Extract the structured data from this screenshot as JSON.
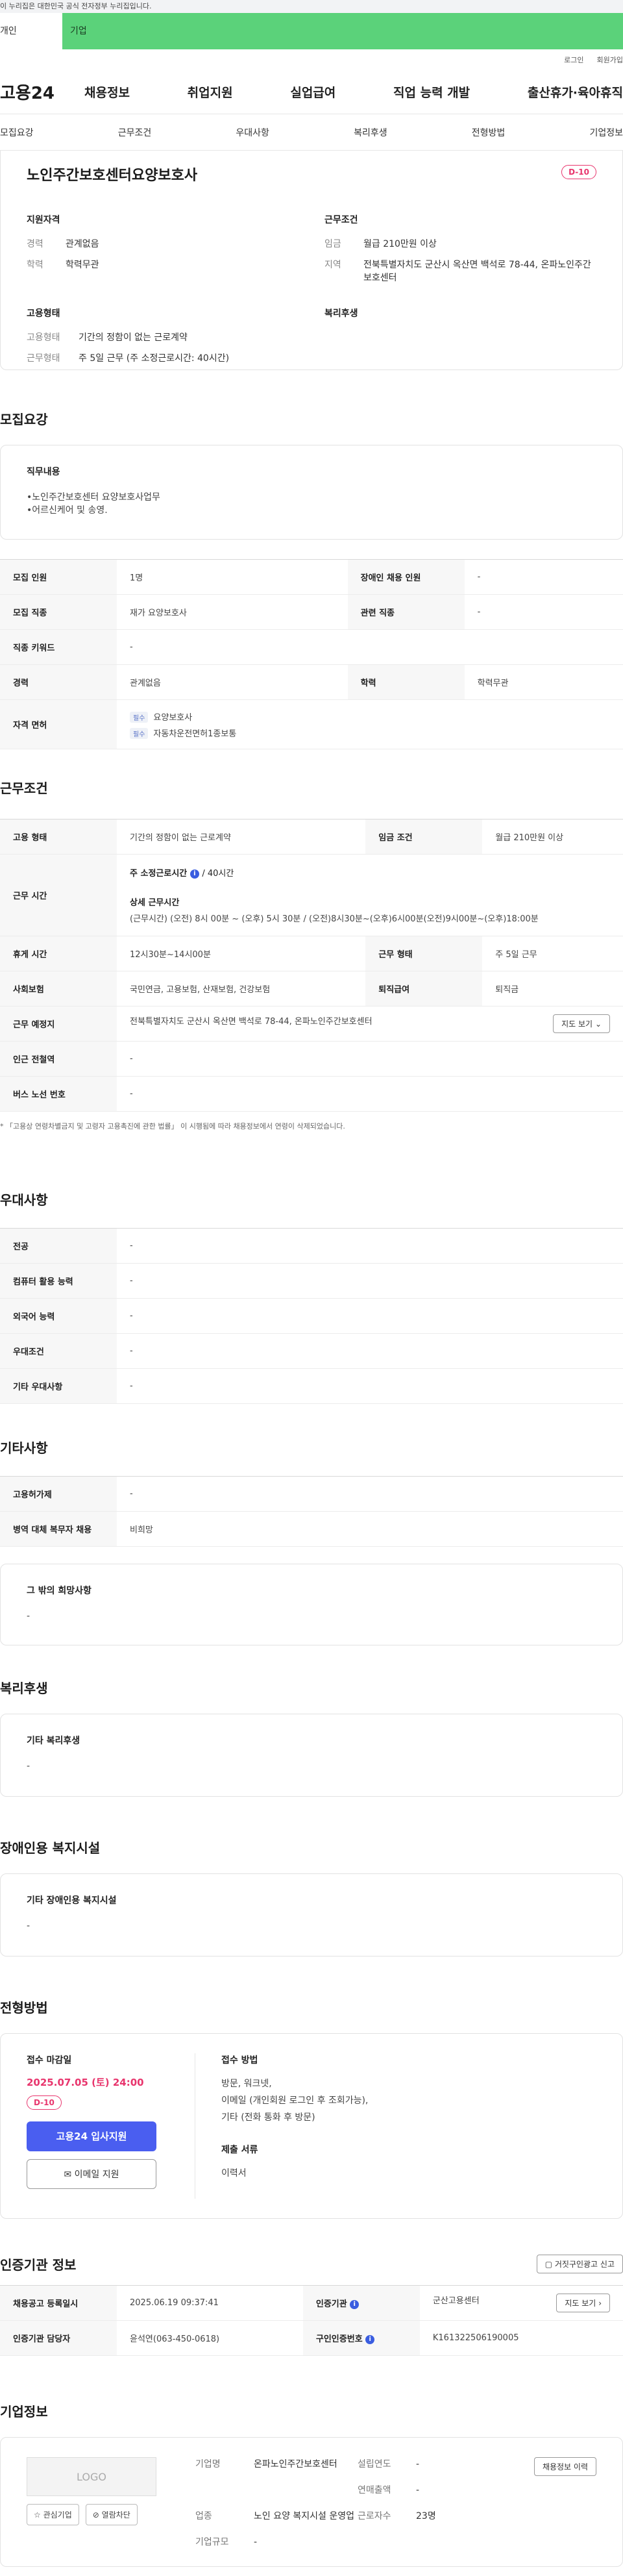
{
  "gov_notice": "이 누리집은 대한민국 공식 전자정부 누리집입니다.",
  "top_tabs": [
    "개인",
    "기업"
  ],
  "util_links": [
    "로그인",
    "회원가입"
  ],
  "gnb": {
    "logo": "고용24",
    "menu": [
      "채용정보",
      "취업지원",
      "실업급여",
      "직업 능력 개발",
      "출산휴가·육아휴직"
    ]
  },
  "anchor_nav": [
    "모집요강",
    "근무조건",
    "우대사항",
    "복리후생",
    "전형방법",
    "기업정보"
  ],
  "summary": {
    "title": "노인주간보호센터요양보호사",
    "dday": "D-10",
    "qualification": {
      "heading": "지원자격",
      "items": [
        {
          "k": "경력",
          "v": "관계없음"
        },
        {
          "k": "학력",
          "v": "학력무관"
        }
      ]
    },
    "conditions": {
      "heading": "근무조건",
      "items": [
        {
          "k": "임금",
          "v": "월급 210만원 이상"
        },
        {
          "k": "지역",
          "v": "전북특별자치도 군산시 옥산면 백석로 78-44, 온파노인주간보호센터"
        }
      ]
    },
    "employment": {
      "heading": "고용형태",
      "items": [
        {
          "k": "고용형태",
          "v": "기간의 정함이 없는 근로계약"
        },
        {
          "k": "근무형태",
          "v": "주 5일 근무 (주 소정근로시간: 40시간)"
        }
      ]
    },
    "welfare_heading": "복리후생"
  },
  "recruit": {
    "title": "모집요강",
    "duty_title": "직무내용",
    "duty_lines": [
      "•노인주간보호센터 요양보호사업무",
      "•어르신케어 및 송영."
    ],
    "rows": [
      {
        "k1": "모집 인원",
        "v1": "1명",
        "k2": "장애인 채용 인원",
        "v2": "-"
      },
      {
        "k1": "모집 직종",
        "v1": "재가 요양보호사",
        "k2": "관련 직종",
        "v2": "-"
      },
      {
        "k1": "직종 키워드",
        "v1": "-"
      },
      {
        "k1": "경력",
        "v1": "관계없음",
        "k2": "학력",
        "v2": "학력무관"
      }
    ],
    "license_label": "자격 면허",
    "license_badge": "필수",
    "licenses": [
      "요양보호사",
      "자동차운전면허1종보통"
    ]
  },
  "work": {
    "title": "근무조건",
    "rows": {
      "type_k": "고용 형태",
      "type_v": "기간의 정함이 없는 근로계약",
      "wage_k": "임금 조건",
      "wage_v": "월급 210만원 이상",
      "time_k": "근무 시간",
      "time_main": "주 소정근로시간",
      "time_main_value": "/ 40시간",
      "time_detail_title": "상세 근무시간",
      "time_detail": "(근무시간) (오전) 8시 00분 ~ (오후) 5시 30분 / (오전)8시30분~(오후)6시00분(오전)9시00분~(오후)18:00분",
      "break_k": "휴게 시간",
      "break_v": "12시30분~14시00분",
      "shift_k": "근무 형태",
      "shift_v": "주 5일 근무",
      "insurance_k": "사회보험",
      "insurance_v": "국민연금, 고용보험, 산재보험, 건강보험",
      "severance_k": "퇴직급여",
      "severance_v": "퇴직금",
      "place_k": "근무 예정지",
      "place_v": "전북특별자치도 군산시 옥산면 백석로 78-44, 온파노인주간보호센터",
      "map_btn": "지도 보기",
      "subway_k": "인근 전철역",
      "subway_v": "-",
      "bus_k": "버스 노선 번호",
      "bus_v": "-"
    },
    "note": "* 「고용상 연령차별금지 및 고령자 고용촉진에 관한 법률」 이 시행됨에 따라 채용정보에서 연령이 삭제되었습니다."
  },
  "preference": {
    "title": "우대사항",
    "rows": [
      {
        "k": "전공",
        "v": "-"
      },
      {
        "k": "컴퓨터 활용 능력",
        "v": "-"
      },
      {
        "k": "외국어 능력",
        "v": "-"
      },
      {
        "k": "우대조건",
        "v": "-"
      },
      {
        "k": "기타 우대사항",
        "v": "-"
      }
    ]
  },
  "etc": {
    "title": "기타사항",
    "rows": [
      {
        "k": "고용허가제",
        "v": "-"
      },
      {
        "k": "병역 대체 복무자 채용",
        "v": "비희망"
      }
    ],
    "other_title": "그 밖의 희망사항",
    "other_value": "-"
  },
  "welfare": {
    "title": "복리후생",
    "box_title": "기타 복리후생",
    "box_value": "-"
  },
  "disabled": {
    "title": "장애인용 복지시설",
    "box_title": "기타 장애인용 복지시설",
    "box_value": "-"
  },
  "process": {
    "title": "전형방법",
    "deadline_title": "접수 마감일",
    "deadline": "2025.07.05 (토) 24:00",
    "dday": "D-10",
    "apply_btn": "고용24 입사지원",
    "email_btn": "이메일 지원",
    "method_title": "접수 방법",
    "methods": [
      "방문, 워크넷,",
      "이메일 (개인회원 로그인 후 조회가능),",
      "기타 (전화 통화 후 방문)"
    ],
    "docs_title": "제출 서류",
    "docs": "이력서"
  },
  "agency": {
    "title": "인증기관 정보",
    "report_btn": "거짓구인광고 신고",
    "rows": [
      {
        "k1": "채용공고 등록일시",
        "v1": "2025.06.19 09:37:41",
        "k2": "인증기관",
        "v2": "군산고용센터"
      },
      {
        "k1": "인증기관 담당자",
        "v1": "윤석연(063-450-0618)",
        "k2": "구인인증번호",
        "v2": "K161322506190005"
      }
    ],
    "map_btn": "지도 보기"
  },
  "company": {
    "title": "기업정보",
    "logo_text": "LOGO",
    "fav_btn": "관심기업",
    "block_btn": "열람차단",
    "history_btn": "채용정보 이력",
    "fields": [
      {
        "k": "기업명",
        "v": "온파노인주간보호센터"
      },
      {
        "k": "설립연도",
        "v": "-"
      },
      {
        "k": "",
        "v": ""
      },
      {
        "k": "연매출액",
        "v": "-"
      },
      {
        "k": "업종",
        "v": "노인 요양 복지시설 운영업"
      },
      {
        "k": "근로자수",
        "v": "23명"
      },
      {
        "k": "기업규모",
        "v": "-"
      }
    ]
  }
}
